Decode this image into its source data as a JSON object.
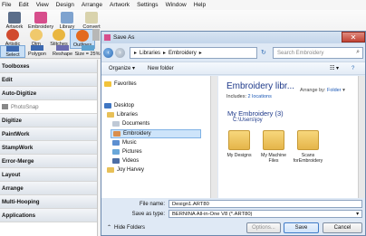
{
  "menu": [
    "File",
    "Edit",
    "View",
    "Design",
    "Arrange",
    "Artwork",
    "Settings",
    "Window",
    "Help"
  ],
  "ribbon": {
    "row1": [
      "Artwork",
      "Embroidery",
      "Library",
      "Convert"
    ],
    "row2": [
      "Artistic",
      "Dim",
      "Stitches",
      "Outlines",
      "Points"
    ],
    "row3": [
      "Select",
      "Polygon",
      "Reshape",
      "Size = 25%"
    ]
  },
  "left_panel": [
    "Toolboxes",
    "Edit",
    "Auto-Digitize",
    "PhotoSnap",
    "Digitize",
    "PaintWork",
    "StampWork",
    "Error-Merge",
    "Layout",
    "Arrange",
    "Multi-Hooping",
    "Applications"
  ],
  "dialog": {
    "title": "Save As",
    "path": [
      "Libraries",
      "Embroidery"
    ],
    "search_placeholder": "Search Embroidery",
    "toolbar": {
      "organize": "Organize",
      "new_folder": "New folder"
    },
    "nav": {
      "favorites": "Favorites",
      "desktop": "Desktop",
      "libraries": "Libraries",
      "documents": "Documents",
      "embroidery": "Embroidery",
      "music": "Music",
      "pictures": "Pictures",
      "videos": "Videos",
      "user": "Joy Harvey"
    },
    "content": {
      "library_title": "Embroidery libr...",
      "includes_prefix": "Includes:",
      "includes_link": "2 locations",
      "arrange_label": "Arrange by:",
      "arrange_value": "Folder",
      "group_title": "My Embroidery (3)",
      "group_path": "C:\\Users\\joy",
      "folders": [
        "My Designs",
        "My Machine Files",
        "Scans forEmbroidery"
      ]
    },
    "fields": {
      "file_name_label": "File name:",
      "file_name_value": "Design1.ART80",
      "type_label": "Save as type:",
      "type_value": "BERNINA All-in-One V8 (*.ART80)"
    },
    "buttons": {
      "hide_folders": "Hide Folders",
      "options": "Options...",
      "save": "Save",
      "cancel": "Cancel"
    }
  }
}
